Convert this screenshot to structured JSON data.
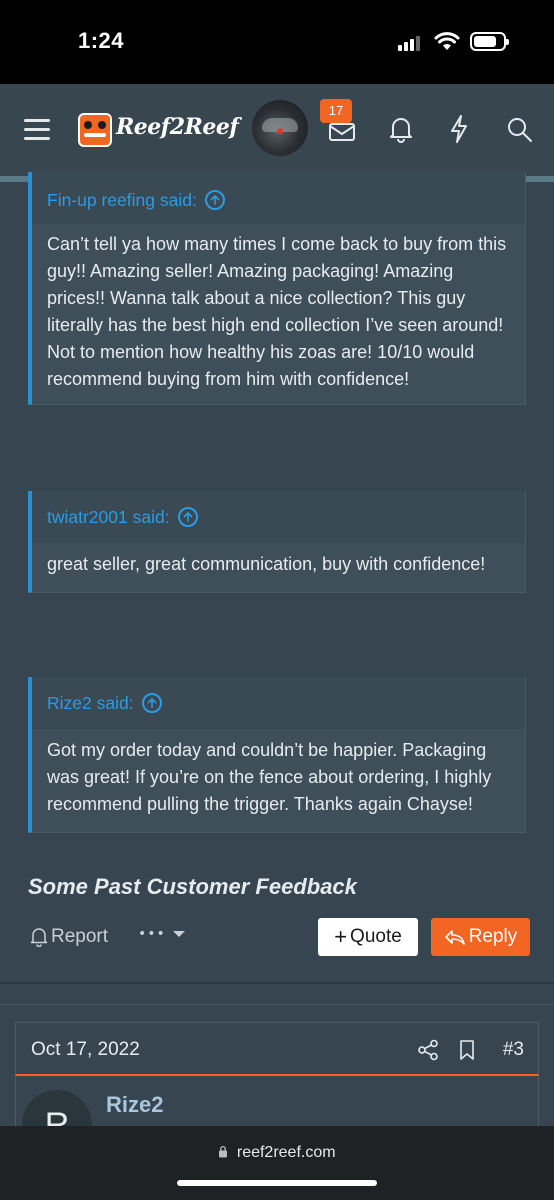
{
  "status_bar": {
    "time": "1:24"
  },
  "header": {
    "logo_text": "Reef2Reef",
    "notification_count": "17",
    "icons": [
      "menu-icon",
      "inbox-icon",
      "bell-icon",
      "lightning-icon",
      "search-icon"
    ]
  },
  "quotes": [
    {
      "author": "Fin-up reefing said:",
      "text": "Can’t tell ya how many times I come back to buy from this guy!! Amazing seller! Amazing packaging! Amazing prices!! Wanna talk about a nice collection? This guy literally has the best high end collection I’ve seen around! Not to mention how healthy his zoas are! 10/10 would recommend buying from him with confidence!"
    },
    {
      "author": "twiatr2001 said:",
      "text": "great seller, great communication, buy with confidence!"
    },
    {
      "author": "Rize2 said:",
      "text": "Got my order today and couldn’t be happier. Packaging was great! If you’re on the fence about ordering, I highly recommend pulling the trigger. Thanks again Chayse!"
    }
  ],
  "feedback_title": "Some Past Customer Feedback",
  "actions": {
    "report_label": "Report",
    "more_label": "•••",
    "quote_label": "Quote",
    "reply_label": "Reply"
  },
  "next_post": {
    "date": "Oct 17, 2022",
    "number": "#3",
    "avatar_letter": "R",
    "username": "Rize2"
  },
  "browser": {
    "url": "reef2reef.com"
  },
  "colors": {
    "background": "#36454f",
    "accent": "#f26522",
    "link": "#2c9be5"
  }
}
